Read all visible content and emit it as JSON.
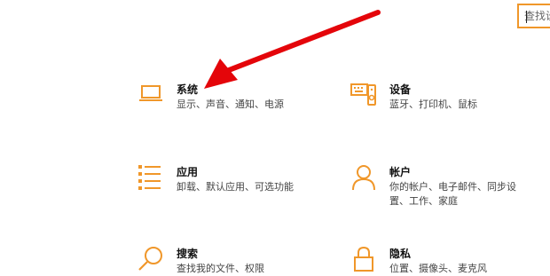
{
  "search": {
    "placeholder": "查找设置"
  },
  "tiles": [
    {
      "title": "系统",
      "desc": "显示、声音、通知、电源"
    },
    {
      "title": "设备",
      "desc": "蓝牙、打印机、鼠标"
    },
    {
      "title": "应用",
      "desc": "卸载、默认应用、可选功能"
    },
    {
      "title": "帐户",
      "desc": "你的帐户、电子邮件、同步设置、工作、家庭"
    },
    {
      "title": "搜索",
      "desc": "查找我的文件、权限"
    },
    {
      "title": "隐私",
      "desc": "位置、摄像头、麦克风"
    }
  ],
  "colors": {
    "accent": "#f0972a",
    "arrow": "#e4050a"
  }
}
